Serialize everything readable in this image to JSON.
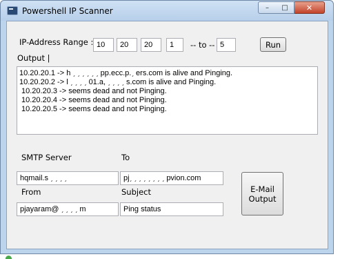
{
  "window": {
    "title": "Powershell IP Scanner",
    "controls": {
      "minimize": "–",
      "maximize": "□",
      "close": "✕"
    }
  },
  "ip_range": {
    "label": "IP-Address Range :",
    "octet1": "10",
    "octet2": "20",
    "octet3": "20",
    "start": "1",
    "separator": "-- to --",
    "end": "5"
  },
  "run_button": "Run",
  "output": {
    "label": "Output |",
    "lines": [
      "10.20.20.1 -> h ˏ ˏ ˏ ˏ ˏ ˏ pp.ecc.p.ˏ ers.com is alive and Pinging.",
      "10.20.20.2 -> l ˏ ˏ ˏ ˏ 01.a, ˏ ˏ ˏ ˏ s.com is alive and Pinging.",
      "10.20.20.3 -> seems dead and not Pinging.",
      "10.20.20.4 -> seems dead and not Pinging.",
      "10.20.20.5 -> seems dead and not Pinging."
    ]
  },
  "email": {
    "smtp_label": "SMTP Server",
    "smtp_value": "hqmail.s ˏ ˏ ˏ ˏ",
    "to_label": "To",
    "to_value": "pjˏ ˏ ˏ ˏ ˏ ˏ ˏ ˏ pvion.com",
    "from_label": "From",
    "from_value": "pjayaram@ ˏ ˏ ˏ ˏ m",
    "subject_label": "Subject",
    "subject_value": "Ping status",
    "send_button": "E-Mail Output"
  }
}
